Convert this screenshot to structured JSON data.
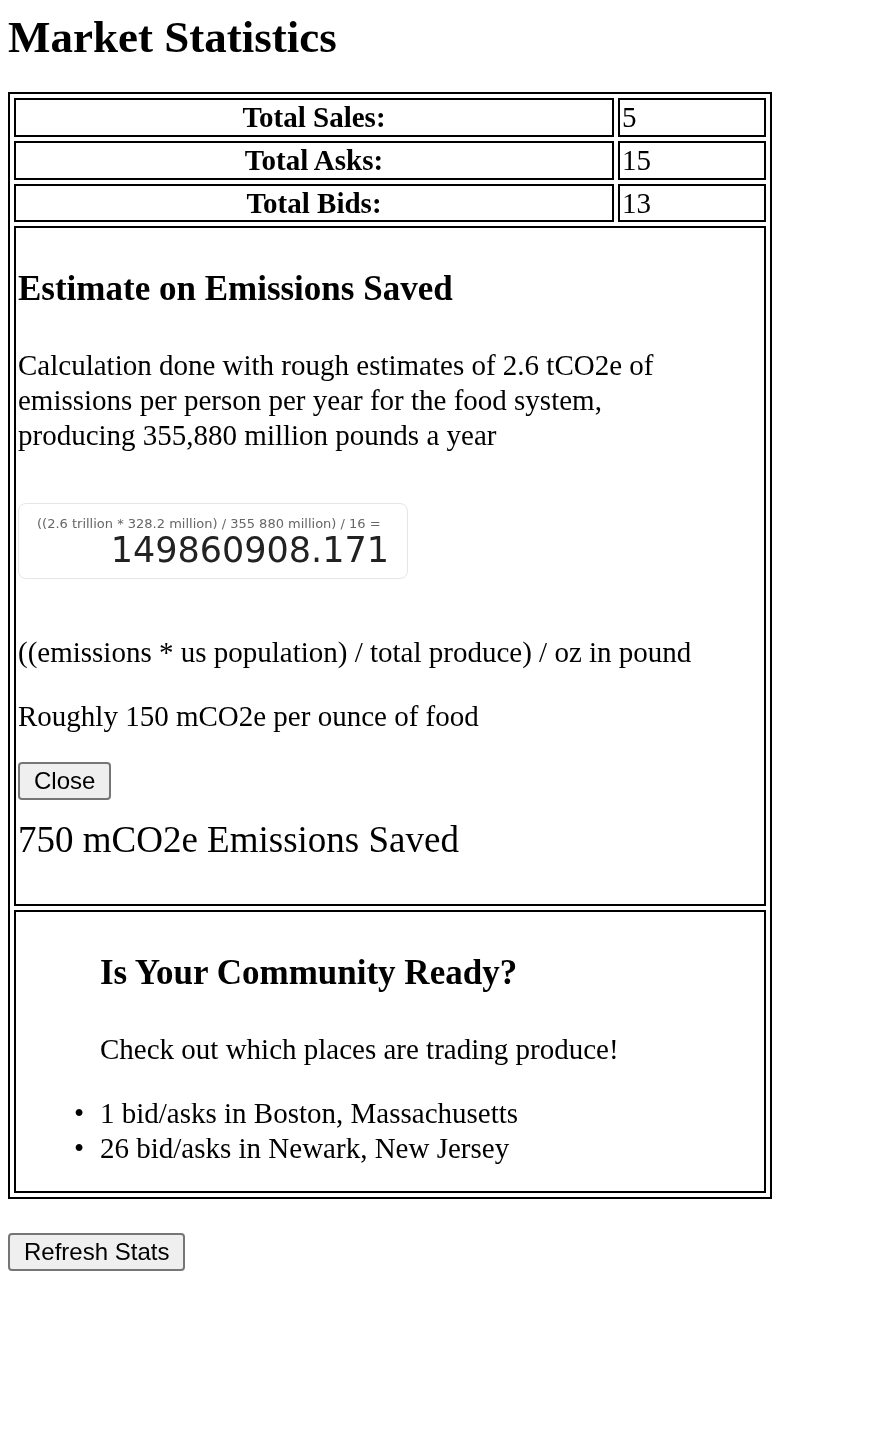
{
  "title": "Market Statistics",
  "stats": [
    {
      "label": "Total Sales:",
      "value": "5"
    },
    {
      "label": "Total Asks:",
      "value": "15"
    },
    {
      "label": "Total Bids:",
      "value": "13"
    }
  ],
  "emissions": {
    "heading": "Estimate on Emissions Saved",
    "description": "Calculation done with rough estimates of 2.6 tCO2e of emissions per person per year for the food system, producing 355,880 million pounds a year",
    "calculator": {
      "expression": "((2.6 trillion * 328.2 million) / 355 880 million) / 16 =",
      "result": "149860908.171"
    },
    "formula": "((emissions * us population) / total produce) / oz in pound",
    "estimate": "Roughly 150 mCO2e per ounce of food",
    "close_button": "Close",
    "saved": "750 mCO2e Emissions Saved"
  },
  "community": {
    "heading": "Is Your Community Ready?",
    "text": "Check out which places are trading produce!",
    "places": [
      {
        "bullet": "•",
        "text": "1 bid/asks in Boston, Massachusetts"
      },
      {
        "bullet": "•",
        "text": "26 bid/asks in Newark, New Jersey"
      }
    ]
  },
  "refresh_button": "Refresh Stats"
}
